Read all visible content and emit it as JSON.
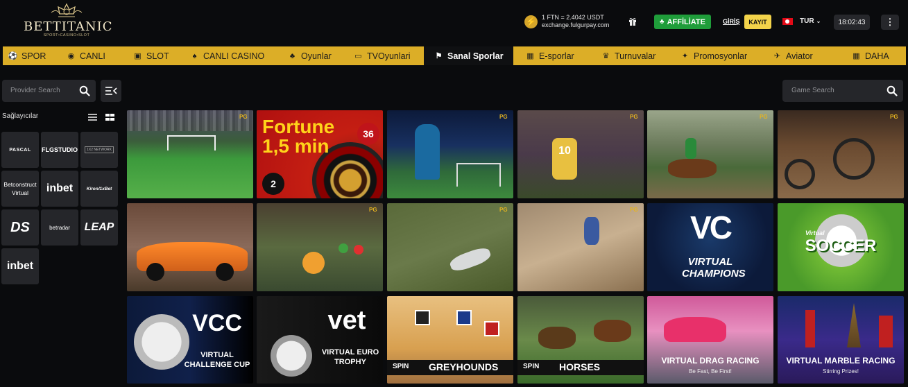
{
  "header": {
    "logo_text": "BETTITANIC",
    "logo_sub": "SPORT•CASINO•SLOT",
    "rate_line1": "1 FTN = 2.4042 USDT",
    "rate_line2": "exchange.fulgurpay.com",
    "affiliate_label": "AFFİLİATE",
    "login_label": "GİRİŞ",
    "register_label": "KAYIT",
    "lang_label": "TUR",
    "clock": "18:02:43",
    "menu_label": "⋮"
  },
  "nav": {
    "items": [
      {
        "label": "SPOR",
        "icon": "soccer-ball-icon",
        "glyph": "⚽"
      },
      {
        "label": "CANLI",
        "icon": "live-dot-icon",
        "glyph": "◉"
      },
      {
        "label": "SLOT",
        "icon": "slot-icon",
        "glyph": "▣"
      },
      {
        "label": "CANLI CASINO",
        "icon": "dealer-icon",
        "glyph": "♠"
      },
      {
        "label": "Oyunlar",
        "icon": "games-icon",
        "glyph": "♣"
      },
      {
        "label": "TVOyunlari",
        "icon": "tv-icon",
        "glyph": "▭"
      },
      {
        "label": "Sanal Sporlar",
        "icon": "virtual-sports-icon",
        "glyph": "⚑"
      },
      {
        "label": "E-sporlar",
        "icon": "esports-icon",
        "glyph": "▦"
      },
      {
        "label": "Turnuvalar",
        "icon": "trophy-icon",
        "glyph": "♛"
      },
      {
        "label": "Promosyonlar",
        "icon": "gift-icon",
        "glyph": "✦"
      },
      {
        "label": "Aviator",
        "icon": "plane-icon",
        "glyph": "✈"
      },
      {
        "label": "DAHA",
        "icon": "more-grid-icon",
        "glyph": "▦"
      }
    ],
    "active_index": 6
  },
  "sidebar": {
    "search_placeholder": "Provider Search",
    "title": "Sağlayıcılar",
    "providers": [
      {
        "label": "PASCAL"
      },
      {
        "label": "FLGSTUDIO"
      },
      {
        "label": "1X2 NETWORK"
      },
      {
        "label": "Betconstruct Virtual"
      },
      {
        "label": "inbet"
      },
      {
        "label": "Kiron/1xBet"
      },
      {
        "label": "DS"
      },
      {
        "label": "betradar"
      },
      {
        "label": "LEAP"
      },
      {
        "label": "inbet"
      }
    ]
  },
  "main": {
    "search_placeholder": "Game Search",
    "games": [
      {
        "title": ""
      },
      {
        "title": "Fortune 1,5 min"
      },
      {
        "title": ""
      },
      {
        "title": ""
      },
      {
        "title": ""
      },
      {
        "title": ""
      },
      {
        "title": ""
      },
      {
        "title": ""
      },
      {
        "title": ""
      },
      {
        "title": ""
      },
      {
        "title": "VIRTUAL CHAMPIONS"
      },
      {
        "title": "SOCCER"
      },
      {
        "title": "VIRTUAL CHALLENGE CUP"
      },
      {
        "title": "VIRTUAL EURO TROPHY"
      },
      {
        "title": "GREYHOUNDS"
      },
      {
        "title": "HORSES"
      },
      {
        "title": "VIRTUAL DRAG RACING"
      },
      {
        "title": "VIRTUAL MARBLE RACING"
      }
    ],
    "game_badges": {
      "vc_abbr": "VC",
      "soccer_tag": "Virtual",
      "fortune_number": "36",
      "fortune_ball": "2",
      "vcc_abbr": "VCC",
      "vet_abbr": "vet",
      "spin_label": "SPIN",
      "drag_tagline": "Be Fast, Be First!",
      "marble_tagline": "Stirring Prizes!"
    }
  },
  "colors": {
    "nav_bg": "#dcae27",
    "affiliate_green": "#1f9d3a",
    "register_yellow": "#f3d34a",
    "page_bg": "#0a0b0d"
  }
}
